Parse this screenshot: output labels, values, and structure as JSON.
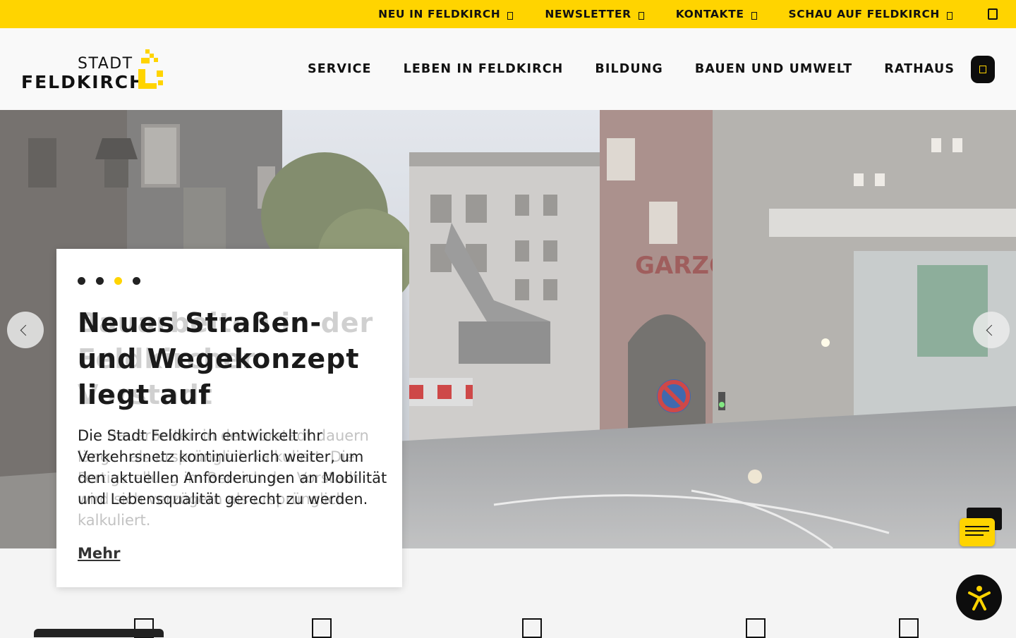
{
  "topbar": {
    "links": [
      {
        "label": "NEU IN FELDKIRCH"
      },
      {
        "label": "NEWSLETTER"
      },
      {
        "label": "KONTAKTE"
      },
      {
        "label": "SCHAU AUF FELDKIRCH"
      }
    ],
    "search_icon": "search-icon",
    "background": "#ffd400"
  },
  "header": {
    "logo_small": "STADT",
    "logo_large": "FELDKIRCH",
    "nav": [
      {
        "label": "SERVICE"
      },
      {
        "label": "LEBEN IN FELDKIRCH"
      },
      {
        "label": "BILDUNG"
      },
      {
        "label": "BAUEN UND UMWELT"
      },
      {
        "label": "RATHAUS"
      }
    ],
    "menu_icon": "menu-icon"
  },
  "slider": {
    "active_slide_index": 3,
    "slide_count": 4,
    "title": "Neues Straßen- und Wegekonzept liegt auf",
    "ghost_title": "Bauarbeiten in der Feldkircher Vorstadt",
    "text": "Die Stadt Feldkirch entwickelt ihr Verkehrsnetz kontinuierlich weiter, um den aktuellen Anforderungen an Mobilität und Lebensqualität gerecht zu werden.",
    "ghost_text": "Die Bauarbeiten in der Vorstadt dauern länger als ursprünglich kalkuliert. Die Fertigstellung im Bereich der Vorstadt wird sich verzögern als ursprünglich kalkuliert.",
    "more_label": "Mehr",
    "prev_icon": "chevron-left-icon",
    "next_icon": "chevron-right-icon"
  },
  "widgets": {
    "chat_icon": "chat-icon",
    "accessibility_icon": "accessibility-icon"
  },
  "colors": {
    "accent": "#ffd400",
    "dark": "#0d0d0d"
  }
}
